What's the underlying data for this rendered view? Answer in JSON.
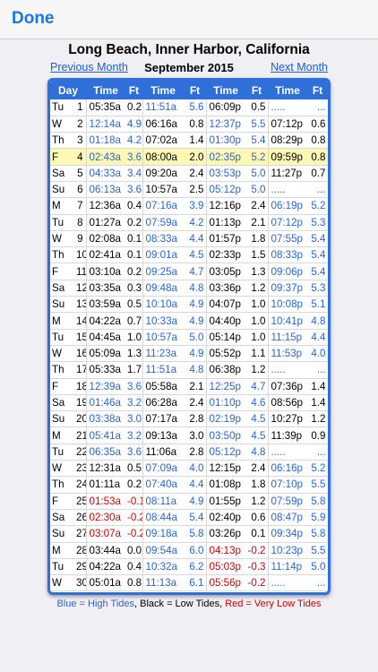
{
  "nav": {
    "done_label": "Done"
  },
  "title": "Long Beach, Inner Harbor, California",
  "month_nav": {
    "prev_label": "Previous Month",
    "current": "September 2015",
    "next_label": "Next Month"
  },
  "headers": [
    "Day",
    "Time",
    "Ft",
    "Time",
    "Ft",
    "Time",
    "Ft",
    "Time",
    "Ft"
  ],
  "rows": [
    {
      "dow": "Tu",
      "day": "1",
      "tides": [
        {
          "t": "05:35a",
          "f": "0.2",
          "k": "L"
        },
        {
          "t": "11:51a",
          "f": "5.6",
          "k": "H"
        },
        {
          "t": "06:09p",
          "f": "0.5",
          "k": "L"
        },
        {
          "t": ".....",
          "f": "...",
          "k": "E"
        }
      ]
    },
    {
      "dow": "W",
      "day": "2",
      "tides": [
        {
          "t": "12:14a",
          "f": "4.9",
          "k": "H"
        },
        {
          "t": "06:16a",
          "f": "0.8",
          "k": "L"
        },
        {
          "t": "12:37p",
          "f": "5.5",
          "k": "H"
        },
        {
          "t": "07:12p",
          "f": "0.6",
          "k": "L"
        }
      ]
    },
    {
      "dow": "Th",
      "day": "3",
      "tides": [
        {
          "t": "01:18a",
          "f": "4.2",
          "k": "H"
        },
        {
          "t": "07:02a",
          "f": "1.4",
          "k": "L"
        },
        {
          "t": "01:30p",
          "f": "5.4",
          "k": "H"
        },
        {
          "t": "08:29p",
          "f": "0.8",
          "k": "L"
        }
      ]
    },
    {
      "dow": "F",
      "day": "4",
      "hl": true,
      "tides": [
        {
          "t": "02:43a",
          "f": "3.6",
          "k": "H"
        },
        {
          "t": "08:00a",
          "f": "2.0",
          "k": "L"
        },
        {
          "t": "02:35p",
          "f": "5.2",
          "k": "H"
        },
        {
          "t": "09:59p",
          "f": "0.8",
          "k": "L"
        }
      ]
    },
    {
      "dow": "Sa",
      "day": "5",
      "tides": [
        {
          "t": "04:33a",
          "f": "3.4",
          "k": "H"
        },
        {
          "t": "09:20a",
          "f": "2.4",
          "k": "L"
        },
        {
          "t": "03:53p",
          "f": "5.0",
          "k": "H"
        },
        {
          "t": "11:27p",
          "f": "0.7",
          "k": "L"
        }
      ]
    },
    {
      "dow": "Su",
      "day": "6",
      "tides": [
        {
          "t": "06:13a",
          "f": "3.6",
          "k": "H"
        },
        {
          "t": "10:57a",
          "f": "2.5",
          "k": "L"
        },
        {
          "t": "05:12p",
          "f": "5.0",
          "k": "H"
        },
        {
          "t": ".....",
          "f": "...",
          "k": "E"
        }
      ]
    },
    {
      "dow": "M",
      "day": "7",
      "tides": [
        {
          "t": "12:36a",
          "f": "0.4",
          "k": "L"
        },
        {
          "t": "07:16a",
          "f": "3.9",
          "k": "H"
        },
        {
          "t": "12:16p",
          "f": "2.4",
          "k": "L"
        },
        {
          "t": "06:19p",
          "f": "5.2",
          "k": "H"
        }
      ]
    },
    {
      "dow": "Tu",
      "day": "8",
      "tides": [
        {
          "t": "01:27a",
          "f": "0.2",
          "k": "L"
        },
        {
          "t": "07:59a",
          "f": "4.2",
          "k": "H"
        },
        {
          "t": "01:13p",
          "f": "2.1",
          "k": "L"
        },
        {
          "t": "07:12p",
          "f": "5.3",
          "k": "H"
        }
      ]
    },
    {
      "dow": "W",
      "day": "9",
      "tides": [
        {
          "t": "02:08a",
          "f": "0.1",
          "k": "L"
        },
        {
          "t": "08:33a",
          "f": "4.4",
          "k": "H"
        },
        {
          "t": "01:57p",
          "f": "1.8",
          "k": "L"
        },
        {
          "t": "07:55p",
          "f": "5.4",
          "k": "H"
        }
      ]
    },
    {
      "dow": "Th",
      "day": "10",
      "tides": [
        {
          "t": "02:41a",
          "f": "0.1",
          "k": "L"
        },
        {
          "t": "09:01a",
          "f": "4.5",
          "k": "H"
        },
        {
          "t": "02:33p",
          "f": "1.5",
          "k": "L"
        },
        {
          "t": "08:33p",
          "f": "5.4",
          "k": "H"
        }
      ]
    },
    {
      "dow": "F",
      "day": "11",
      "tides": [
        {
          "t": "03:10a",
          "f": "0.2",
          "k": "L"
        },
        {
          "t": "09:25a",
          "f": "4.7",
          "k": "H"
        },
        {
          "t": "03:05p",
          "f": "1.3",
          "k": "L"
        },
        {
          "t": "09:06p",
          "f": "5.4",
          "k": "H"
        }
      ]
    },
    {
      "dow": "Sa",
      "day": "12",
      "tides": [
        {
          "t": "03:35a",
          "f": "0.3",
          "k": "L"
        },
        {
          "t": "09:48a",
          "f": "4.8",
          "k": "H"
        },
        {
          "t": "03:36p",
          "f": "1.2",
          "k": "L"
        },
        {
          "t": "09:37p",
          "f": "5.3",
          "k": "H"
        }
      ]
    },
    {
      "dow": "Su",
      "day": "13",
      "tides": [
        {
          "t": "03:59a",
          "f": "0.5",
          "k": "L"
        },
        {
          "t": "10:10a",
          "f": "4.9",
          "k": "H"
        },
        {
          "t": "04:07p",
          "f": "1.0",
          "k": "L"
        },
        {
          "t": "10:08p",
          "f": "5.1",
          "k": "H"
        }
      ]
    },
    {
      "dow": "M",
      "day": "14",
      "tides": [
        {
          "t": "04:22a",
          "f": "0.7",
          "k": "L"
        },
        {
          "t": "10:33a",
          "f": "4.9",
          "k": "H"
        },
        {
          "t": "04:40p",
          "f": "1.0",
          "k": "L"
        },
        {
          "t": "10:41p",
          "f": "4.8",
          "k": "H"
        }
      ]
    },
    {
      "dow": "Tu",
      "day": "15",
      "tides": [
        {
          "t": "04:45a",
          "f": "1.0",
          "k": "L"
        },
        {
          "t": "10:57a",
          "f": "5.0",
          "k": "H"
        },
        {
          "t": "05:14p",
          "f": "1.0",
          "k": "L"
        },
        {
          "t": "11:15p",
          "f": "4.4",
          "k": "H"
        }
      ]
    },
    {
      "dow": "W",
      "day": "16",
      "tides": [
        {
          "t": "05:09a",
          "f": "1.3",
          "k": "L"
        },
        {
          "t": "11:23a",
          "f": "4.9",
          "k": "H"
        },
        {
          "t": "05:52p",
          "f": "1.1",
          "k": "L"
        },
        {
          "t": "11:53p",
          "f": "4.0",
          "k": "H"
        }
      ]
    },
    {
      "dow": "Th",
      "day": "17",
      "tides": [
        {
          "t": "05:33a",
          "f": "1.7",
          "k": "L"
        },
        {
          "t": "11:51a",
          "f": "4.8",
          "k": "H"
        },
        {
          "t": "06:38p",
          "f": "1.2",
          "k": "L"
        },
        {
          "t": ".....",
          "f": "...",
          "k": "E"
        }
      ]
    },
    {
      "dow": "F",
      "day": "18",
      "tides": [
        {
          "t": "12:39a",
          "f": "3.6",
          "k": "H"
        },
        {
          "t": "05:58a",
          "f": "2.1",
          "k": "L"
        },
        {
          "t": "12:25p",
          "f": "4.7",
          "k": "H"
        },
        {
          "t": "07:36p",
          "f": "1.4",
          "k": "L"
        }
      ]
    },
    {
      "dow": "Sa",
      "day": "19",
      "tides": [
        {
          "t": "01:46a",
          "f": "3.2",
          "k": "H"
        },
        {
          "t": "06:28a",
          "f": "2.4",
          "k": "L"
        },
        {
          "t": "01:10p",
          "f": "4.6",
          "k": "H"
        },
        {
          "t": "08:56p",
          "f": "1.4",
          "k": "L"
        }
      ]
    },
    {
      "dow": "Su",
      "day": "20",
      "tides": [
        {
          "t": "03:38a",
          "f": "3.0",
          "k": "H"
        },
        {
          "t": "07:17a",
          "f": "2.8",
          "k": "L"
        },
        {
          "t": "02:19p",
          "f": "4.5",
          "k": "H"
        },
        {
          "t": "10:27p",
          "f": "1.2",
          "k": "L"
        }
      ]
    },
    {
      "dow": "M",
      "day": "21",
      "tides": [
        {
          "t": "05:41a",
          "f": "3.2",
          "k": "H"
        },
        {
          "t": "09:13a",
          "f": "3.0",
          "k": "L"
        },
        {
          "t": "03:50p",
          "f": "4.5",
          "k": "H"
        },
        {
          "t": "11:39p",
          "f": "0.9",
          "k": "L"
        }
      ]
    },
    {
      "dow": "Tu",
      "day": "22",
      "tides": [
        {
          "t": "06:35a",
          "f": "3.6",
          "k": "H"
        },
        {
          "t": "11:06a",
          "f": "2.8",
          "k": "L"
        },
        {
          "t": "05:12p",
          "f": "4.8",
          "k": "H"
        },
        {
          "t": ".....",
          "f": "...",
          "k": "E"
        }
      ]
    },
    {
      "dow": "W",
      "day": "23",
      "tides": [
        {
          "t": "12:31a",
          "f": "0.5",
          "k": "L"
        },
        {
          "t": "07:09a",
          "f": "4.0",
          "k": "H"
        },
        {
          "t": "12:15p",
          "f": "2.4",
          "k": "L"
        },
        {
          "t": "06:16p",
          "f": "5.2",
          "k": "H"
        }
      ]
    },
    {
      "dow": "Th",
      "day": "24",
      "tides": [
        {
          "t": "01:11a",
          "f": "0.2",
          "k": "L"
        },
        {
          "t": "07:40a",
          "f": "4.4",
          "k": "H"
        },
        {
          "t": "01:08p",
          "f": "1.8",
          "k": "L"
        },
        {
          "t": "07:10p",
          "f": "5.5",
          "k": "H"
        }
      ]
    },
    {
      "dow": "F",
      "day": "25",
      "tides": [
        {
          "t": "01:53a",
          "f": "-0.1",
          "k": "V"
        },
        {
          "t": "08:11a",
          "f": "4.9",
          "k": "H"
        },
        {
          "t": "01:55p",
          "f": "1.2",
          "k": "L"
        },
        {
          "t": "07:59p",
          "f": "5.8",
          "k": "H"
        }
      ]
    },
    {
      "dow": "Sa",
      "day": "26",
      "tides": [
        {
          "t": "02:30a",
          "f": "-0.2",
          "k": "V"
        },
        {
          "t": "08:44a",
          "f": "5.4",
          "k": "H"
        },
        {
          "t": "02:40p",
          "f": "0.6",
          "k": "L"
        },
        {
          "t": "08:47p",
          "f": "5.9",
          "k": "H"
        }
      ]
    },
    {
      "dow": "Su",
      "day": "27",
      "tides": [
        {
          "t": "03:07a",
          "f": "-0.2",
          "k": "V"
        },
        {
          "t": "09:18a",
          "f": "5.8",
          "k": "H"
        },
        {
          "t": "03:26p",
          "f": "0.1",
          "k": "L"
        },
        {
          "t": "09:34p",
          "f": "5.8",
          "k": "H"
        }
      ]
    },
    {
      "dow": "M",
      "day": "28",
      "tides": [
        {
          "t": "03:44a",
          "f": "0.0",
          "k": "L"
        },
        {
          "t": "09:54a",
          "f": "6.0",
          "k": "H"
        },
        {
          "t": "04:13p",
          "f": "-0.2",
          "k": "V"
        },
        {
          "t": "10:23p",
          "f": "5.5",
          "k": "H"
        }
      ]
    },
    {
      "dow": "Tu",
      "day": "29",
      "tides": [
        {
          "t": "04:22a",
          "f": "0.4",
          "k": "L"
        },
        {
          "t": "10:32a",
          "f": "6.2",
          "k": "H"
        },
        {
          "t": "05:03p",
          "f": "-0.3",
          "k": "V"
        },
        {
          "t": "11:14p",
          "f": "5.0",
          "k": "H"
        }
      ]
    },
    {
      "dow": "W",
      "day": "30",
      "tides": [
        {
          "t": "05:01a",
          "f": "0.8",
          "k": "L"
        },
        {
          "t": "11:13a",
          "f": "6.1",
          "k": "H"
        },
        {
          "t": "05:56p",
          "f": "-0.2",
          "k": "V"
        },
        {
          "t": ".....",
          "f": "...",
          "k": "E"
        }
      ]
    }
  ],
  "legend": {
    "blue": "Blue = High Tides",
    "sep1": ", ",
    "black": "Black = Low Tides",
    "sep2": ", ",
    "red": "Red = Very Low Tides"
  },
  "colors": {
    "high": "#2a66c9",
    "low": "#000000",
    "very_low": "#d10000",
    "accent": "#2f6fd9",
    "highlight": "#fdf9b5"
  }
}
